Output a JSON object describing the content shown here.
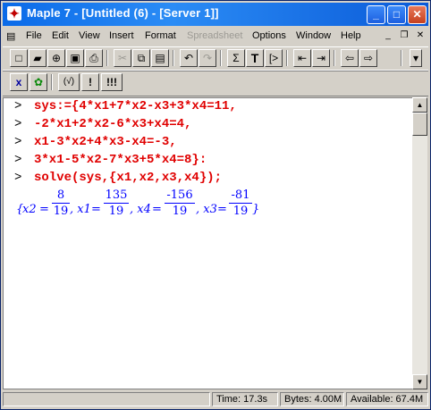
{
  "window": {
    "title": "Maple 7  - [Untitled (6) - [Server 1]]"
  },
  "menu": [
    "File",
    "Edit",
    "View",
    "Insert",
    "Format",
    "Spreadsheet",
    "Options",
    "Window",
    "Help"
  ],
  "toolbar2": {
    "x_label": "x",
    "check_label": "(√)",
    "bang1": "!",
    "bang3": "!!!"
  },
  "toolbar1": {
    "sigma": "Σ",
    "text_t": "T",
    "prompt_btn": "[>"
  },
  "worksheet": {
    "prompt": ">",
    "lines": [
      "sys:={4*x1+7*x2-x3+3*x4=11,",
      "-2*x1+2*x2-6*x3+x4=4,",
      "x1-3*x2+4*x3-x4=-3,",
      "3*x1-5*x2-7*x3+5*x4=8}:",
      "solve(sys,{x1,x2,x3,x4});"
    ],
    "output": {
      "open": "{",
      "var1": "x2",
      "eq": "=",
      "n1": "8",
      "d1": "19",
      "var2": ", x1",
      "n2": "135",
      "d2": "19",
      "var3": ", x4",
      "n3": "-156",
      "d3": "19",
      "var4": ", x3",
      "n4": "-81",
      "d4": "19",
      "close": "}"
    }
  },
  "status": {
    "time": "Time:  17.3s",
    "bytes": "Bytes: 4.00M",
    "available": "Available: 67.4M"
  }
}
